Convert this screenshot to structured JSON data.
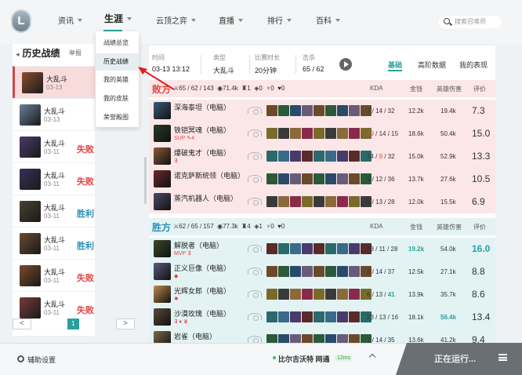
{
  "topbar": {
    "logo": "L",
    "nav": [
      {
        "label": "资讯"
      },
      {
        "label": "生涯"
      },
      {
        "label": "云顶之弈"
      },
      {
        "label": "直播"
      },
      {
        "label": "排行"
      },
      {
        "label": "百科"
      }
    ],
    "search_placeholder": "搜索召唤师"
  },
  "sidebar": {
    "back": "◂",
    "title": "历史战绩",
    "report": "举报",
    "matches": [
      {
        "mode": "大乱斗",
        "date": "03-13",
        "result": "",
        "rtype": "",
        "c": "#8a5030"
      },
      {
        "mode": "大乱斗",
        "date": "03-13",
        "result": "",
        "rtype": "",
        "c": "#6a7f9a"
      },
      {
        "mode": "大乱斗",
        "date": "03-11",
        "result": "失败",
        "rtype": "lose",
        "c": "#4a3a6a"
      },
      {
        "mode": "大乱斗",
        "date": "03-11",
        "result": "失败",
        "rtype": "lose",
        "c": "#3a3058"
      },
      {
        "mode": "大乱斗",
        "date": "03-11",
        "result": "胜利",
        "rtype": "win",
        "c": "#4a4030"
      },
      {
        "mode": "大乱斗",
        "date": "03-11",
        "result": "胜利",
        "rtype": "win",
        "c": "#6a4a30"
      },
      {
        "mode": "大乱斗",
        "date": "03-11",
        "result": "失败",
        "rtype": "lose",
        "c": "#7a4a2a"
      },
      {
        "mode": "大乱斗",
        "date": "03-11",
        "result": "失败",
        "rtype": "lose",
        "c": "#7a3a3a"
      }
    ],
    "page": "1",
    "prev": "<",
    "next": ">"
  },
  "submenu": {
    "items": [
      "战绩总览",
      "历史战绩",
      "我的英雄",
      "我的皮肤",
      "荣誉殿图"
    ]
  },
  "match": {
    "time_label": "时间",
    "time": "03-13 13:12",
    "type_label": "类型",
    "type": "大乱斗",
    "dur_label": "比赛时长",
    "dur": "20分钟",
    "kills_label": "击杀",
    "kills": "65 / 62",
    "tabs": [
      "基础",
      "高阶数据",
      "我的表现"
    ]
  },
  "headers": {
    "kda": "KDA",
    "gold": "金钱",
    "dmg": "英雄伤害",
    "score": "评价"
  },
  "teams": [
    {
      "name": "败方",
      "kda": "65 / 62 / 143",
      "gold": "71.4k",
      "t": "1",
      "d": "0",
      "b": "0",
      "h": "0",
      "type": "lose",
      "players": [
        {
          "name": "深海泰坦（电脑）",
          "badges": "",
          "kda_pre": "7 / 14 / 32",
          "k": "",
          "kda": "",
          "gold": "12.2k",
          "dmg": "19.4k",
          "score": "7.3",
          "c": "#3a5a7a",
          "gh": false,
          "dh": false,
          "sh": false
        },
        {
          "name": "铁铠冥魂（电脑）",
          "badges": "SUP ✎4",
          "kda_pre": "",
          "k": "29",
          "kda": " / 14 / 15",
          "gold": "18.6k",
          "dmg": "50.4k",
          "score": "15.0",
          "c": "#2a3a2a",
          "gh": false,
          "dh": false,
          "sh": false
        },
        {
          "name": "爆破鬼才（电脑）",
          "badges": "∃",
          "kda_pre": "14 / ",
          "k": "9",
          "kda": " / 32",
          "gold": "15.0k",
          "dmg": "52.9k",
          "score": "13.3",
          "c": "#8a5a3a",
          "gh": false,
          "dh": false,
          "sh": false
        },
        {
          "name": "诺克萨斯统领（电脑）",
          "badges": "",
          "kda_pre": "9 / 12 / 36",
          "k": "",
          "kda": "",
          "gold": "13.7k",
          "dmg": "27.6k",
          "score": "10.5",
          "c": "#6a2a2a",
          "gh": false,
          "dh": false,
          "sh": false
        },
        {
          "name": "蒸汽机器人（电脑）",
          "badges": "",
          "kda_pre": "6 / 13 / 28",
          "k": "",
          "kda": "",
          "gold": "12.0k",
          "dmg": "15.5k",
          "score": "6.9",
          "c": "#4a4a6a",
          "gh": false,
          "dh": false,
          "sh": false
        }
      ]
    },
    {
      "name": "胜方",
      "kda": "62 / 65 / 157",
      "gold": "77.3k",
      "t": "4",
      "d": "1",
      "b": "0",
      "h": "0",
      "type": "win",
      "players": [
        {
          "name": "解脱者（电脑）",
          "badges": "MVP ∃",
          "kda_pre": "23 / 11 / 28",
          "k": "",
          "kda": "",
          "gold": "19.2k",
          "dmg": "54.0k",
          "score": "16.0",
          "c": "#3a4a2a",
          "gh": true,
          "dh": false,
          "sh": true
        },
        {
          "name": "正义巨像（电脑）",
          "badges": "◆",
          "kda_pre": "3 / 14 / 37",
          "k": "",
          "kda": "",
          "gold": "12.5k",
          "dmg": "27.1k",
          "score": "8.8",
          "c": "#5a5a7a",
          "gh": false,
          "dh": false,
          "sh": false
        },
        {
          "name": "光辉女郎（电脑）",
          "badges": "✹",
          "kda_pre": "6 / 13 / ",
          "k": "41",
          "kda": "",
          "gold": "13.9k",
          "dmg": "35.7k",
          "score": "8.6",
          "c": "#c08a4a",
          "gh": false,
          "dh": false,
          "sh": false
        },
        {
          "name": "沙漠玫瑰（电脑）",
          "badges": "∃ ♦ ♛",
          "kda_pre": "23 / 13 / 16",
          "k": "",
          "kda": "",
          "gold": "18.1k",
          "dmg": "56.4k",
          "score": "13.4",
          "c": "#5a4a3a",
          "gh": false,
          "dh": true,
          "sh": false
        },
        {
          "name": "岩雀（电脑）",
          "badges": "",
          "kda_pre": "7 / 14 / 35",
          "k": "",
          "kda": "",
          "gold": "13.6k",
          "dmg": "41.2k",
          "score": "9.4",
          "c": "#7a6a4a",
          "gh": false,
          "dh": false,
          "sh": false
        }
      ]
    }
  ],
  "bottom": {
    "settings": "辅助设置",
    "server": "比尔吉沃特 网通",
    "ping": "12ms",
    "running": "正在运行..."
  },
  "colors": {
    "accent": "#2aa198",
    "lose": "#e04444",
    "win": "#2d8fb8"
  }
}
